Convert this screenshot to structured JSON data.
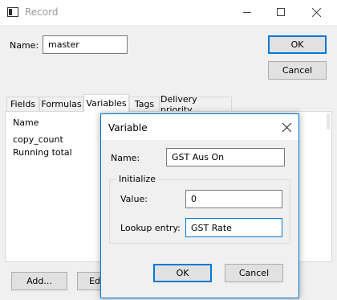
{
  "window": {
    "title": "Record",
    "icon": "window-app-icon",
    "controls": [
      "minimize-icon",
      "maximize-icon",
      "close-icon"
    ]
  },
  "record": {
    "name_label": "Name:",
    "name_value": "master",
    "ok_label": "OK",
    "cancel_label": "Cancel"
  },
  "tabs": [
    {
      "label": "Fields",
      "active": false
    },
    {
      "label": "Formulas",
      "active": false
    },
    {
      "label": "Variables",
      "active": true
    },
    {
      "label": "Tags",
      "active": false
    },
    {
      "label": "Delivery priority",
      "active": false
    }
  ],
  "variables_list": {
    "header": "Name",
    "items": [
      "copy_count",
      "Running total"
    ]
  },
  "bottom_buttons": {
    "add_label": "Add...",
    "edit_label": "Ed"
  },
  "dialog": {
    "title": "Variable",
    "name_label": "Name:",
    "name_value": "GST Aus On",
    "group_label": "Initialize",
    "value_label": "Value:",
    "value_value": "0",
    "lookup_label": "Lookup entry:",
    "lookup_value": "GST Rate",
    "ok_label": "OK",
    "cancel_label": "Cancel"
  },
  "colors": {
    "accent": "#0078d7",
    "window_bg": "#f0f0f0"
  }
}
